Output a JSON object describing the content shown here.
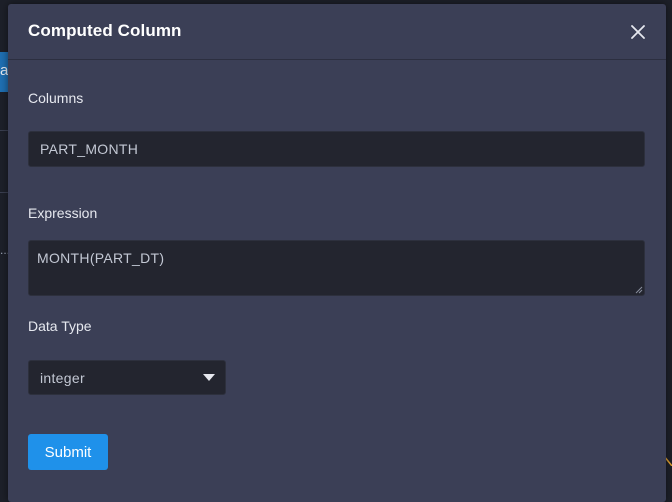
{
  "background": {
    "partial_tab_text": "al",
    "partial_dots": "..."
  },
  "modal": {
    "title": "Computed Column",
    "close_icon": "close-icon"
  },
  "form": {
    "columns_label": "Columns",
    "columns_value": "PART_MONTH",
    "expression_label": "Expression",
    "expression_value": "MONTH(PART_DT)",
    "data_type_label": "Data Type",
    "data_type_value": "integer",
    "submit_label": "Submit"
  },
  "colors": {
    "accent": "#1f91ea",
    "modal_bg": "#3b3f56",
    "input_bg": "#23252f"
  }
}
